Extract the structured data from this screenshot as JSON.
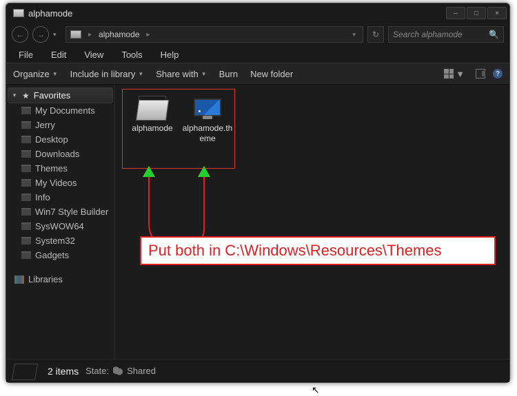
{
  "window": {
    "title": "alphamode",
    "minimize": "–",
    "maximize": "□",
    "close": "×"
  },
  "nav": {
    "back": "←",
    "forward": "→"
  },
  "breadcrumb": {
    "folder": "alphamode",
    "sep": "▸"
  },
  "search": {
    "placeholder": "Search alphamode",
    "icon": "🔍"
  },
  "menubar": {
    "file": "File",
    "edit": "Edit",
    "view": "View",
    "tools": "Tools",
    "help": "Help"
  },
  "toolbar": {
    "organize": "Organize",
    "include": "Include in library",
    "share": "Share with",
    "burn": "Burn",
    "newfolder": "New folder",
    "help": "?"
  },
  "sidebar": {
    "favorites_label": "Favorites",
    "favorites": [
      {
        "label": "My Documents"
      },
      {
        "label": "Jerry"
      },
      {
        "label": "Desktop"
      },
      {
        "label": "Downloads"
      },
      {
        "label": "Themes"
      },
      {
        "label": "My Videos"
      },
      {
        "label": "Info"
      },
      {
        "label": "Win7 Style Builder"
      },
      {
        "label": "SysWOW64"
      },
      {
        "label": "System32"
      },
      {
        "label": "Gadgets"
      }
    ],
    "libraries_label": "Libraries"
  },
  "files": [
    {
      "name": "alphamode"
    },
    {
      "name": "alphamode.theme"
    }
  ],
  "annotation": {
    "text": "Put both in C:\\Windows\\Resources\\Themes"
  },
  "status": {
    "count": "2 items",
    "state_label": "State:",
    "state_value": "Shared"
  }
}
